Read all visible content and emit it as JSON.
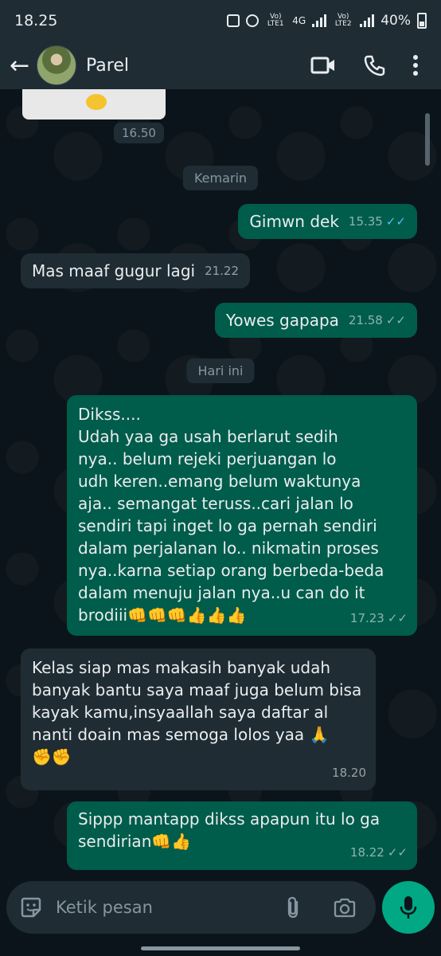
{
  "status_bar": {
    "time": "18.25",
    "sim1": "Vo) LTE1",
    "network": "4G",
    "sim2": "Vo) LTE2",
    "battery": "40%"
  },
  "header": {
    "back_icon": "arrow-left-icon",
    "contact_name": "Parel",
    "icons": [
      "video-call-icon",
      "voice-call-icon",
      "more-vert-icon"
    ]
  },
  "chat": {
    "prev_media_time": "16.50",
    "date_chips": [
      "Kemarin",
      "Hari ini"
    ],
    "messages": [
      {
        "dir": "out",
        "text": "Gimwn dek",
        "time": "15.35",
        "ticks": "read"
      },
      {
        "dir": "in",
        "text": "Mas maaf gugur lagi",
        "time": "21.22"
      },
      {
        "dir": "out",
        "text": "Yowes gapapa",
        "time": "21.58",
        "ticks": "delivered"
      },
      {
        "dir": "out",
        "text": "Dikss....\nUdah yaa ga usah berlarut sedih\nnya.. belum rejeki perjuangan lo\nudh keren..emang belum waktunya\naja.. semangat teruss..cari jalan lo\nsendiri tapi inget lo ga pernah sendiri\ndalam perjalanan lo.. nikmatin proses\nnya..karna setiap orang berbeda-beda\ndalam menuju jalan nya..u can do it\nbrodiii👊👊👊👍👍👍",
        "time": "17.23",
        "ticks": "delivered"
      },
      {
        "dir": "in",
        "text": "Kelas siap mas makasih banyak udah\nbanyak bantu saya maaf juga belum bisa\nkayak kamu,insyaallah saya daftar al\nnanti doain mas semoga lolos yaa 🙏\n✊✊",
        "time": "18.20"
      },
      {
        "dir": "out",
        "text": "Sippp mantapp dikss apapun itu lo ga\nsendirian👊👍",
        "time": "18.22",
        "ticks": "delivered"
      }
    ]
  },
  "input": {
    "placeholder": "Ketik pesan",
    "emoji_icon": "sticker-icon",
    "attach_icon": "paperclip-icon",
    "camera_icon": "camera-icon",
    "mic_icon": "mic-icon"
  },
  "colors": {
    "background": "#0b141a",
    "bar": "#1f2c34",
    "outgoing": "#005c4b",
    "incoming": "#1f2c34",
    "accent": "#00a884",
    "read_ticks": "#53bdeb"
  }
}
